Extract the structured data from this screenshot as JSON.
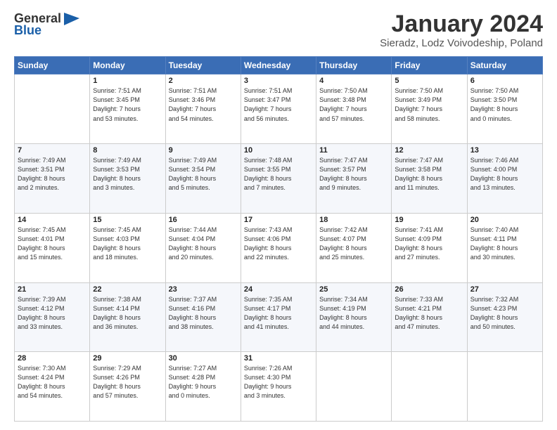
{
  "header": {
    "logo_line1": "General",
    "logo_line2": "Blue",
    "title": "January 2024",
    "subtitle": "Sieradz, Lodz Voivodeship, Poland"
  },
  "days_of_week": [
    "Sunday",
    "Monday",
    "Tuesday",
    "Wednesday",
    "Thursday",
    "Friday",
    "Saturday"
  ],
  "weeks": [
    [
      {
        "day": "",
        "info": ""
      },
      {
        "day": "1",
        "info": "Sunrise: 7:51 AM\nSunset: 3:45 PM\nDaylight: 7 hours\nand 53 minutes."
      },
      {
        "day": "2",
        "info": "Sunrise: 7:51 AM\nSunset: 3:46 PM\nDaylight: 7 hours\nand 54 minutes."
      },
      {
        "day": "3",
        "info": "Sunrise: 7:51 AM\nSunset: 3:47 PM\nDaylight: 7 hours\nand 56 minutes."
      },
      {
        "day": "4",
        "info": "Sunrise: 7:50 AM\nSunset: 3:48 PM\nDaylight: 7 hours\nand 57 minutes."
      },
      {
        "day": "5",
        "info": "Sunrise: 7:50 AM\nSunset: 3:49 PM\nDaylight: 7 hours\nand 58 minutes."
      },
      {
        "day": "6",
        "info": "Sunrise: 7:50 AM\nSunset: 3:50 PM\nDaylight: 8 hours\nand 0 minutes."
      }
    ],
    [
      {
        "day": "7",
        "info": "Sunrise: 7:49 AM\nSunset: 3:51 PM\nDaylight: 8 hours\nand 2 minutes."
      },
      {
        "day": "8",
        "info": "Sunrise: 7:49 AM\nSunset: 3:53 PM\nDaylight: 8 hours\nand 3 minutes."
      },
      {
        "day": "9",
        "info": "Sunrise: 7:49 AM\nSunset: 3:54 PM\nDaylight: 8 hours\nand 5 minutes."
      },
      {
        "day": "10",
        "info": "Sunrise: 7:48 AM\nSunset: 3:55 PM\nDaylight: 8 hours\nand 7 minutes."
      },
      {
        "day": "11",
        "info": "Sunrise: 7:47 AM\nSunset: 3:57 PM\nDaylight: 8 hours\nand 9 minutes."
      },
      {
        "day": "12",
        "info": "Sunrise: 7:47 AM\nSunset: 3:58 PM\nDaylight: 8 hours\nand 11 minutes."
      },
      {
        "day": "13",
        "info": "Sunrise: 7:46 AM\nSunset: 4:00 PM\nDaylight: 8 hours\nand 13 minutes."
      }
    ],
    [
      {
        "day": "14",
        "info": "Sunrise: 7:45 AM\nSunset: 4:01 PM\nDaylight: 8 hours\nand 15 minutes."
      },
      {
        "day": "15",
        "info": "Sunrise: 7:45 AM\nSunset: 4:03 PM\nDaylight: 8 hours\nand 18 minutes."
      },
      {
        "day": "16",
        "info": "Sunrise: 7:44 AM\nSunset: 4:04 PM\nDaylight: 8 hours\nand 20 minutes."
      },
      {
        "day": "17",
        "info": "Sunrise: 7:43 AM\nSunset: 4:06 PM\nDaylight: 8 hours\nand 22 minutes."
      },
      {
        "day": "18",
        "info": "Sunrise: 7:42 AM\nSunset: 4:07 PM\nDaylight: 8 hours\nand 25 minutes."
      },
      {
        "day": "19",
        "info": "Sunrise: 7:41 AM\nSunset: 4:09 PM\nDaylight: 8 hours\nand 27 minutes."
      },
      {
        "day": "20",
        "info": "Sunrise: 7:40 AM\nSunset: 4:11 PM\nDaylight: 8 hours\nand 30 minutes."
      }
    ],
    [
      {
        "day": "21",
        "info": "Sunrise: 7:39 AM\nSunset: 4:12 PM\nDaylight: 8 hours\nand 33 minutes."
      },
      {
        "day": "22",
        "info": "Sunrise: 7:38 AM\nSunset: 4:14 PM\nDaylight: 8 hours\nand 36 minutes."
      },
      {
        "day": "23",
        "info": "Sunrise: 7:37 AM\nSunset: 4:16 PM\nDaylight: 8 hours\nand 38 minutes."
      },
      {
        "day": "24",
        "info": "Sunrise: 7:35 AM\nSunset: 4:17 PM\nDaylight: 8 hours\nand 41 minutes."
      },
      {
        "day": "25",
        "info": "Sunrise: 7:34 AM\nSunset: 4:19 PM\nDaylight: 8 hours\nand 44 minutes."
      },
      {
        "day": "26",
        "info": "Sunrise: 7:33 AM\nSunset: 4:21 PM\nDaylight: 8 hours\nand 47 minutes."
      },
      {
        "day": "27",
        "info": "Sunrise: 7:32 AM\nSunset: 4:23 PM\nDaylight: 8 hours\nand 50 minutes."
      }
    ],
    [
      {
        "day": "28",
        "info": "Sunrise: 7:30 AM\nSunset: 4:24 PM\nDaylight: 8 hours\nand 54 minutes."
      },
      {
        "day": "29",
        "info": "Sunrise: 7:29 AM\nSunset: 4:26 PM\nDaylight: 8 hours\nand 57 minutes."
      },
      {
        "day": "30",
        "info": "Sunrise: 7:27 AM\nSunset: 4:28 PM\nDaylight: 9 hours\nand 0 minutes."
      },
      {
        "day": "31",
        "info": "Sunrise: 7:26 AM\nSunset: 4:30 PM\nDaylight: 9 hours\nand 3 minutes."
      },
      {
        "day": "",
        "info": ""
      },
      {
        "day": "",
        "info": ""
      },
      {
        "day": "",
        "info": ""
      }
    ]
  ]
}
